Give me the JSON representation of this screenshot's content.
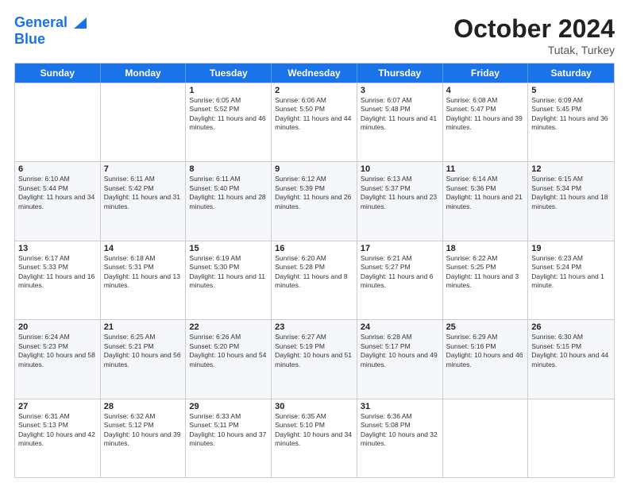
{
  "logo": {
    "line1": "General",
    "line2": "Blue"
  },
  "title": "October 2024",
  "subtitle": "Tutak, Turkey",
  "header_days": [
    "Sunday",
    "Monday",
    "Tuesday",
    "Wednesday",
    "Thursday",
    "Friday",
    "Saturday"
  ],
  "weeks": [
    [
      {
        "day": "",
        "sunrise": "",
        "sunset": "",
        "daylight": ""
      },
      {
        "day": "",
        "sunrise": "",
        "sunset": "",
        "daylight": ""
      },
      {
        "day": "1",
        "sunrise": "Sunrise: 6:05 AM",
        "sunset": "Sunset: 5:52 PM",
        "daylight": "Daylight: 11 hours and 46 minutes."
      },
      {
        "day": "2",
        "sunrise": "Sunrise: 6:06 AM",
        "sunset": "Sunset: 5:50 PM",
        "daylight": "Daylight: 11 hours and 44 minutes."
      },
      {
        "day": "3",
        "sunrise": "Sunrise: 6:07 AM",
        "sunset": "Sunset: 5:48 PM",
        "daylight": "Daylight: 11 hours and 41 minutes."
      },
      {
        "day": "4",
        "sunrise": "Sunrise: 6:08 AM",
        "sunset": "Sunset: 5:47 PM",
        "daylight": "Daylight: 11 hours and 39 minutes."
      },
      {
        "day": "5",
        "sunrise": "Sunrise: 6:09 AM",
        "sunset": "Sunset: 5:45 PM",
        "daylight": "Daylight: 11 hours and 36 minutes."
      }
    ],
    [
      {
        "day": "6",
        "sunrise": "Sunrise: 6:10 AM",
        "sunset": "Sunset: 5:44 PM",
        "daylight": "Daylight: 11 hours and 34 minutes."
      },
      {
        "day": "7",
        "sunrise": "Sunrise: 6:11 AM",
        "sunset": "Sunset: 5:42 PM",
        "daylight": "Daylight: 11 hours and 31 minutes."
      },
      {
        "day": "8",
        "sunrise": "Sunrise: 6:11 AM",
        "sunset": "Sunset: 5:40 PM",
        "daylight": "Daylight: 11 hours and 28 minutes."
      },
      {
        "day": "9",
        "sunrise": "Sunrise: 6:12 AM",
        "sunset": "Sunset: 5:39 PM",
        "daylight": "Daylight: 11 hours and 26 minutes."
      },
      {
        "day": "10",
        "sunrise": "Sunrise: 6:13 AM",
        "sunset": "Sunset: 5:37 PM",
        "daylight": "Daylight: 11 hours and 23 minutes."
      },
      {
        "day": "11",
        "sunrise": "Sunrise: 6:14 AM",
        "sunset": "Sunset: 5:36 PM",
        "daylight": "Daylight: 11 hours and 21 minutes."
      },
      {
        "day": "12",
        "sunrise": "Sunrise: 6:15 AM",
        "sunset": "Sunset: 5:34 PM",
        "daylight": "Daylight: 11 hours and 18 minutes."
      }
    ],
    [
      {
        "day": "13",
        "sunrise": "Sunrise: 6:17 AM",
        "sunset": "Sunset: 5:33 PM",
        "daylight": "Daylight: 11 hours and 16 minutes."
      },
      {
        "day": "14",
        "sunrise": "Sunrise: 6:18 AM",
        "sunset": "Sunset: 5:31 PM",
        "daylight": "Daylight: 11 hours and 13 minutes."
      },
      {
        "day": "15",
        "sunrise": "Sunrise: 6:19 AM",
        "sunset": "Sunset: 5:30 PM",
        "daylight": "Daylight: 11 hours and 11 minutes."
      },
      {
        "day": "16",
        "sunrise": "Sunrise: 6:20 AM",
        "sunset": "Sunset: 5:28 PM",
        "daylight": "Daylight: 11 hours and 8 minutes."
      },
      {
        "day": "17",
        "sunrise": "Sunrise: 6:21 AM",
        "sunset": "Sunset: 5:27 PM",
        "daylight": "Daylight: 11 hours and 6 minutes."
      },
      {
        "day": "18",
        "sunrise": "Sunrise: 6:22 AM",
        "sunset": "Sunset: 5:25 PM",
        "daylight": "Daylight: 11 hours and 3 minutes."
      },
      {
        "day": "19",
        "sunrise": "Sunrise: 6:23 AM",
        "sunset": "Sunset: 5:24 PM",
        "daylight": "Daylight: 11 hours and 1 minute."
      }
    ],
    [
      {
        "day": "20",
        "sunrise": "Sunrise: 6:24 AM",
        "sunset": "Sunset: 5:23 PM",
        "daylight": "Daylight: 10 hours and 58 minutes."
      },
      {
        "day": "21",
        "sunrise": "Sunrise: 6:25 AM",
        "sunset": "Sunset: 5:21 PM",
        "daylight": "Daylight: 10 hours and 56 minutes."
      },
      {
        "day": "22",
        "sunrise": "Sunrise: 6:26 AM",
        "sunset": "Sunset: 5:20 PM",
        "daylight": "Daylight: 10 hours and 54 minutes."
      },
      {
        "day": "23",
        "sunrise": "Sunrise: 6:27 AM",
        "sunset": "Sunset: 5:19 PM",
        "daylight": "Daylight: 10 hours and 51 minutes."
      },
      {
        "day": "24",
        "sunrise": "Sunrise: 6:28 AM",
        "sunset": "Sunset: 5:17 PM",
        "daylight": "Daylight: 10 hours and 49 minutes."
      },
      {
        "day": "25",
        "sunrise": "Sunrise: 6:29 AM",
        "sunset": "Sunset: 5:16 PM",
        "daylight": "Daylight: 10 hours and 46 minutes."
      },
      {
        "day": "26",
        "sunrise": "Sunrise: 6:30 AM",
        "sunset": "Sunset: 5:15 PM",
        "daylight": "Daylight: 10 hours and 44 minutes."
      }
    ],
    [
      {
        "day": "27",
        "sunrise": "Sunrise: 6:31 AM",
        "sunset": "Sunset: 5:13 PM",
        "daylight": "Daylight: 10 hours and 42 minutes."
      },
      {
        "day": "28",
        "sunrise": "Sunrise: 6:32 AM",
        "sunset": "Sunset: 5:12 PM",
        "daylight": "Daylight: 10 hours and 39 minutes."
      },
      {
        "day": "29",
        "sunrise": "Sunrise: 6:33 AM",
        "sunset": "Sunset: 5:11 PM",
        "daylight": "Daylight: 10 hours and 37 minutes."
      },
      {
        "day": "30",
        "sunrise": "Sunrise: 6:35 AM",
        "sunset": "Sunset: 5:10 PM",
        "daylight": "Daylight: 10 hours and 34 minutes."
      },
      {
        "day": "31",
        "sunrise": "Sunrise: 6:36 AM",
        "sunset": "Sunset: 5:08 PM",
        "daylight": "Daylight: 10 hours and 32 minutes."
      },
      {
        "day": "",
        "sunrise": "",
        "sunset": "",
        "daylight": ""
      },
      {
        "day": "",
        "sunrise": "",
        "sunset": "",
        "daylight": ""
      }
    ]
  ]
}
